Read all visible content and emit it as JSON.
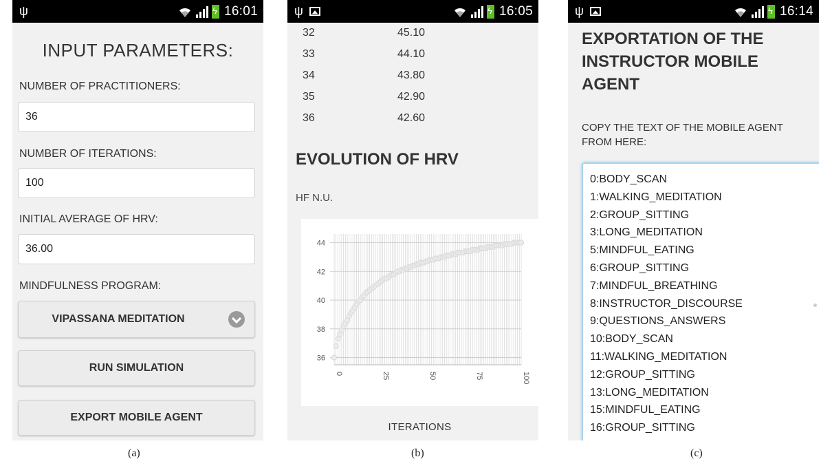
{
  "statusbar": {
    "usb_glyph": "ψ",
    "clock_a": "16:01",
    "clock_b": "16:05",
    "clock_c": "16:14",
    "icons": [
      "usb-icon",
      "image-icon",
      "wifi-icon",
      "signal-icon",
      "battery-icon"
    ]
  },
  "panel_a": {
    "title": "INPUT PARAMETERS:",
    "practitioners_label": "NUMBER OF PRACTITIONERS:",
    "practitioners_value": "36",
    "iterations_label": "NUMBER OF ITERATIONS:",
    "iterations_value": "100",
    "hrv_label": "INITIAL AVERAGE OF HRV:",
    "hrv_value": "36.00",
    "program_label": "MINDFULNESS PROGRAM:",
    "program_selected": "VIPASSANA MEDITATION",
    "run_button": "RUN SIMULATION",
    "export_button": "EXPORT MOBILE AGENT",
    "caption": "(a)"
  },
  "panel_b": {
    "rows": [
      {
        "iteration": "32",
        "value": "45.10"
      },
      {
        "iteration": "33",
        "value": "44.10"
      },
      {
        "iteration": "34",
        "value": "43.80"
      },
      {
        "iteration": "35",
        "value": "42.90"
      },
      {
        "iteration": "36",
        "value": "42.60"
      }
    ],
    "title": "EVOLUTION OF HRV",
    "subtitle": "HF N.U.",
    "xlabel": "ITERATIONS",
    "caption": "(b)"
  },
  "chart_data": {
    "type": "scatter",
    "title": "EVOLUTION OF HRV",
    "ylabel": "HF N.U.",
    "xlabel": "ITERATIONS",
    "xlim": [
      0,
      100
    ],
    "ylim": [
      35.5,
      44.6
    ],
    "xticks": [
      "0",
      "25",
      "50",
      "75",
      "100"
    ],
    "yticks": [
      "36",
      "38",
      "40",
      "42",
      "44"
    ],
    "grid": true,
    "series": [
      {
        "values": [
          [
            0,
            36.0
          ],
          [
            1,
            36.8
          ],
          [
            2,
            37.3
          ],
          [
            3,
            37.6
          ],
          [
            4,
            37.9
          ],
          [
            5,
            38.2
          ],
          [
            6,
            38.4
          ],
          [
            7,
            38.6
          ],
          [
            8,
            38.9
          ],
          [
            9,
            39.1
          ],
          [
            10,
            39.3
          ],
          [
            11,
            39.5
          ],
          [
            12,
            39.7
          ],
          [
            13,
            39.9
          ],
          [
            14,
            40.0
          ],
          [
            15,
            40.2
          ],
          [
            16,
            40.3
          ],
          [
            17,
            40.5
          ],
          [
            18,
            40.6
          ],
          [
            19,
            40.7
          ],
          [
            20,
            40.8
          ],
          [
            21,
            40.9
          ],
          [
            22,
            41.0
          ],
          [
            23,
            41.1
          ],
          [
            24,
            41.2
          ],
          [
            25,
            41.3
          ],
          [
            26,
            41.4
          ],
          [
            27,
            41.5
          ],
          [
            28,
            41.5
          ],
          [
            29,
            41.6
          ],
          [
            30,
            41.7
          ],
          [
            31,
            41.8
          ],
          [
            32,
            41.8
          ],
          [
            33,
            41.9
          ],
          [
            34,
            42.0
          ],
          [
            35,
            42.0
          ],
          [
            36,
            42.1
          ],
          [
            37,
            42.1
          ],
          [
            38,
            42.2
          ],
          [
            39,
            42.2
          ],
          [
            40,
            42.3
          ],
          [
            41,
            42.3
          ],
          [
            42,
            42.4
          ],
          [
            43,
            42.4
          ],
          [
            44,
            42.5
          ],
          [
            45,
            42.5
          ],
          [
            46,
            42.6
          ],
          [
            47,
            42.6
          ],
          [
            48,
            42.6
          ],
          [
            49,
            42.7
          ],
          [
            50,
            42.7
          ],
          [
            51,
            42.8
          ],
          [
            52,
            42.8
          ],
          [
            53,
            42.8
          ],
          [
            54,
            42.9
          ],
          [
            55,
            42.9
          ],
          [
            56,
            42.9
          ],
          [
            57,
            43.0
          ],
          [
            58,
            43.0
          ],
          [
            59,
            43.0
          ],
          [
            60,
            43.1
          ],
          [
            61,
            43.1
          ],
          [
            62,
            43.1
          ],
          [
            63,
            43.2
          ],
          [
            64,
            43.2
          ],
          [
            65,
            43.2
          ],
          [
            66,
            43.3
          ],
          [
            67,
            43.3
          ],
          [
            68,
            43.3
          ],
          [
            69,
            43.3
          ],
          [
            70,
            43.4
          ],
          [
            71,
            43.4
          ],
          [
            72,
            43.4
          ],
          [
            73,
            43.4
          ],
          [
            74,
            43.5
          ],
          [
            75,
            43.5
          ],
          [
            76,
            43.5
          ],
          [
            77,
            43.5
          ],
          [
            78,
            43.6
          ],
          [
            79,
            43.6
          ],
          [
            80,
            43.6
          ],
          [
            81,
            43.6
          ],
          [
            82,
            43.7
          ],
          [
            83,
            43.7
          ],
          [
            84,
            43.7
          ],
          [
            85,
            43.7
          ],
          [
            86,
            43.8
          ],
          [
            87,
            43.8
          ],
          [
            88,
            43.8
          ],
          [
            89,
            43.8
          ],
          [
            90,
            43.8
          ],
          [
            91,
            43.9
          ],
          [
            92,
            43.9
          ],
          [
            93,
            43.9
          ],
          [
            94,
            43.9
          ],
          [
            95,
            43.9
          ],
          [
            96,
            44.0
          ],
          [
            97,
            44.0
          ],
          [
            98,
            44.0
          ],
          [
            99,
            44.0
          ],
          [
            100,
            44.0
          ]
        ]
      }
    ]
  },
  "panel_c": {
    "title": "EXPORTATION OF THE INSTRUCTOR MOBILE AGENT",
    "label": "COPY THE TEXT OF THE MOBILE AGENT FROM HERE:",
    "lines": [
      "0:BODY_SCAN",
      "1:WALKING_MEDITATION",
      "2:GROUP_SITTING",
      "3:LONG_MEDITATION",
      "5:MINDFUL_EATING",
      "6:GROUP_SITTING",
      "7:MINDFUL_BREATHING",
      "8:INSTRUCTOR_DISCOURSE",
      "9:QUESTIONS_ANSWERS",
      "10:BODY_SCAN",
      "11:WALKING_MEDITATION",
      "12:GROUP_SITTING",
      "13:LONG_MEDITATION",
      "15:MINDFUL_EATING",
      "16:GROUP_SITTING"
    ],
    "caption": "(c)"
  },
  "colors": {
    "screen_background": "#f1f1f1",
    "statusbar": "#000000",
    "battery": "#5fbf24",
    "textarea_focus": "#a8d3ee",
    "chart_points": "#dcdcdc",
    "chart_grid": "#cfcfcf"
  }
}
